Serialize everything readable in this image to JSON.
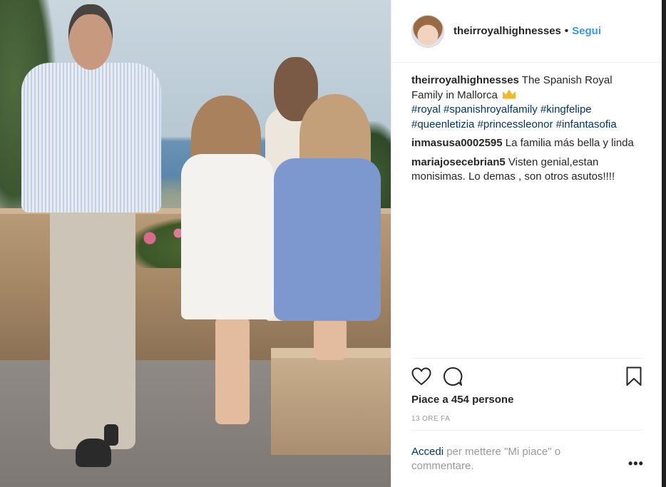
{
  "post": {
    "username": "theirroyalhighnesses",
    "separator": "•",
    "follow_label": "Segui"
  },
  "caption": {
    "username": "theirroyalhighnesses",
    "text": "The Spanish Royal Family in Mallorca",
    "emoji": "crown-emoji",
    "hashtags": "#royal #spanishroyalfamily #kingfelipe #queenletizia #princessleonor #infantasofia"
  },
  "comments": [
    {
      "username": "inmasusa0002595",
      "text": "La familia más bella y linda"
    },
    {
      "username": "mariajosecebrian5",
      "text": "Visten genial,estan monisimas. Lo demas , son otros asutos!!!!"
    }
  ],
  "actions": {
    "like_icon": "heart-icon",
    "comment_icon": "comment-icon",
    "save_icon": "bookmark-icon"
  },
  "likes_text": "Piace a 454 persone",
  "timestamp": "13 ORE FA",
  "login": {
    "link": "Accedi",
    "text": "per mettere \"Mi piace\" o commentare."
  },
  "more_label": "•••",
  "colors": {
    "link_blue": "#3897f0",
    "hashtag_blue": "#003569",
    "text": "#262626",
    "muted": "#999999"
  }
}
